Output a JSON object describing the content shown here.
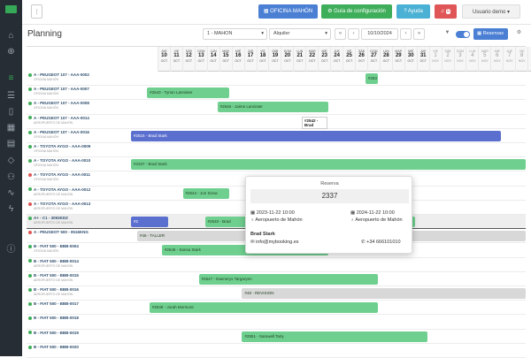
{
  "topbar": {
    "office": "OFICINA MAHÓN",
    "config": "Guía de configuración",
    "help": "Ayuda",
    "notif_count": "0",
    "user": "Usuario demo"
  },
  "planning": {
    "title": "Planning",
    "office_select": "1 - MAHON",
    "type_select": "Alquiler",
    "date": "10/10/2024",
    "reservas": "Reservas"
  },
  "days": [
    {
      "w": "JUE",
      "d": "10",
      "m": "OCT"
    },
    {
      "w": "VIE",
      "d": "11",
      "m": "OCT"
    },
    {
      "w": "SÁB",
      "d": "12",
      "m": "OCT"
    },
    {
      "w": "DOM",
      "d": "13",
      "m": "OCT"
    },
    {
      "w": "LUN",
      "d": "14",
      "m": "OCT"
    },
    {
      "w": "MAR",
      "d": "15",
      "m": "OCT"
    },
    {
      "w": "MIÉ",
      "d": "16",
      "m": "OCT"
    },
    {
      "w": "JUE",
      "d": "17",
      "m": "OCT"
    },
    {
      "w": "VIE",
      "d": "18",
      "m": "OCT"
    },
    {
      "w": "SÁB",
      "d": "19",
      "m": "OCT"
    },
    {
      "w": "DOM",
      "d": "20",
      "m": "OCT"
    },
    {
      "w": "LUN",
      "d": "21",
      "m": "OCT"
    },
    {
      "w": "MAR",
      "d": "22",
      "m": "OCT"
    },
    {
      "w": "MIÉ",
      "d": "23",
      "m": "OCT"
    },
    {
      "w": "JUE",
      "d": "24",
      "m": "OCT"
    },
    {
      "w": "VIE",
      "d": "25",
      "m": "OCT"
    },
    {
      "w": "SÁB",
      "d": "26",
      "m": "OCT"
    },
    {
      "w": "DOM",
      "d": "27",
      "m": "OCT"
    },
    {
      "w": "LUN",
      "d": "28",
      "m": "OCT"
    },
    {
      "w": "MAR",
      "d": "29",
      "m": "OCT"
    },
    {
      "w": "MIÉ",
      "d": "30",
      "m": "OCT"
    },
    {
      "w": "JUE",
      "d": "31",
      "m": "OCT"
    },
    {
      "w": "VIE",
      "d": "1",
      "m": "NOV"
    },
    {
      "w": "SÁB",
      "d": "2",
      "m": "NOV"
    },
    {
      "w": "DOM",
      "d": "3",
      "m": "NOV"
    },
    {
      "w": "LUN",
      "d": "4",
      "m": "NOV"
    },
    {
      "w": "MAR",
      "d": "5",
      "m": "NOV"
    },
    {
      "w": "MIÉ",
      "d": "6",
      "m": "NOV"
    },
    {
      "w": "JUE",
      "d": "7",
      "m": "NOV"
    },
    {
      "w": "VIE",
      "d": "8",
      "m": "NOV"
    },
    {
      "w": "SÁB",
      "d": "9",
      "m": "NOV"
    },
    {
      "w": "DOM",
      "d": "10",
      "m": "NOV"
    }
  ],
  "vehicles": [
    {
      "name": "A - PEUGEOT 107 - AAA-0002",
      "sub": "OFICINA MAHÓN",
      "color": "#3fae5a"
    },
    {
      "name": "A - PEUGEOT 107 - AAA-0007",
      "sub": "OFICINA MAHÓN",
      "color": "#3fae5a"
    },
    {
      "name": "A - PEUGEOT 107 - AAA-0008",
      "sub": "OFICINA MAHÓN",
      "color": "#3fae5a"
    },
    {
      "name": "A - PEUGEOT 107 - AAA-0014",
      "sub": "AEROPUERTO DE MAHÓN",
      "color": "#3fae5a"
    },
    {
      "name": "A - PEUGEOT 107 - AAA-0016",
      "sub": "OFICINA MAHÓN",
      "color": "#3fae5a"
    },
    {
      "name": "A - TOYOTA AYGO - AAA-0009",
      "sub": "OFICINA MAHÓN",
      "color": "#3fae5a"
    },
    {
      "name": "A - TOYOTA AYGO - AAA-0010",
      "sub": "OFICINA MAHÓN",
      "color": "#3fae5a"
    },
    {
      "name": "A - TOYOTA AYGO - AAA-0011",
      "sub": "OFICINA MAHÓN",
      "color": "#e05555"
    },
    {
      "name": "A - TOYOTA AYGO - AAA-0012",
      "sub": "AEROPUERTO DE MAHÓN",
      "color": "#3fae5a"
    },
    {
      "name": "A - TOYOTA AYGO - AAA-0013",
      "sub": "AEROPUERTO DE MAHÓN",
      "color": "#e05555"
    },
    {
      "name": "A+ - C1 - 3093KDZ",
      "sub": "AEROPUERTO DE MAHÓN",
      "color": "#3fae5a"
    },
    {
      "name": "A - PEUGEOT 500 - 0516KNG",
      "sub": "",
      "color": "#e05555"
    },
    {
      "name": "B - FIAT 500 - BBB-0004",
      "sub": "OFICINA MAHÓN",
      "color": "#3fae5a"
    },
    {
      "name": "B - FIAT 500 - BBB-0014",
      "sub": "AEROPUERTO DE MAHÓN",
      "color": "#3fae5a"
    },
    {
      "name": "B - FIAT 500 - BBB-0015",
      "sub": "AEROPUERTO DE MAHÓN",
      "color": "#3fae5a"
    },
    {
      "name": "B - FIAT 500 - BBB-0016",
      "sub": "AEROPUERTO DE MAHÓN",
      "color": "#3fae5a"
    },
    {
      "name": "B - FIAT 500 - BBB-0017",
      "sub": "",
      "color": "#3fae5a"
    },
    {
      "name": "B - FIAT 500 - BBB-0018",
      "sub": "",
      "color": "#3fae5a"
    },
    {
      "name": "B - FIAT 500 - BBB-0019",
      "sub": "",
      "color": "#3fae5a"
    },
    {
      "name": "B - FIAT 500 - BBB-0020",
      "sub": "",
      "color": "#3fae5a"
    }
  ],
  "bookings": [
    {
      "row": 0,
      "start": 19.0,
      "end": 20.0,
      "label": "#253",
      "color": "#6fcf8f"
    },
    {
      "row": 1,
      "start": 1.3,
      "end": 8.0,
      "label": "#2543 - Tyrion Lannister",
      "color": "#6fcf8f"
    },
    {
      "row": 2,
      "start": 7.0,
      "end": 16.0,
      "label": "#2546 - Jaime Lannister",
      "color": "#6fcf8f"
    },
    {
      "row": 4,
      "start": 0,
      "end": 30.0,
      "label": "#2515 - Brad Stark",
      "color": "#5b6fcf"
    },
    {
      "row": 6,
      "start": 0,
      "end": 32.0,
      "label": "#2337 - Brad Stark",
      "color": "#6fcf8f"
    },
    {
      "row": 8,
      "start": 4.2,
      "end": 8.0,
      "label": "#2544 - Jon Snow",
      "color": "#6fcf8f"
    },
    {
      "row": 10,
      "start": 0,
      "end": 3.0,
      "label": "#2",
      "color": "#5b6fcf"
    },
    {
      "row": 10,
      "start": 6.0,
      "end": 12.0,
      "label": "#2540 - Brad",
      "color": "#6fcf8f"
    },
    {
      "row": 10,
      "start": 22.0,
      "end": 23.0,
      "label": "",
      "color": "#6fcf8f"
    },
    {
      "row": 11,
      "start": 0.5,
      "end": 32.0,
      "label": "#46 - TALLER",
      "color": "#d8d8d8"
    },
    {
      "row": 12,
      "start": 2.5,
      "end": 16.0,
      "label": "#2545 - Sansa Stark",
      "color": "#6fcf8f"
    },
    {
      "row": 14,
      "start": 5.5,
      "end": 20.0,
      "label": "#2547 - Daenerys Targaryen",
      "color": "#6fcf8f"
    },
    {
      "row": 15,
      "start": 9.0,
      "end": 32.0,
      "label": "#48 - REVISION",
      "color": "#d8d8d8"
    },
    {
      "row": 16,
      "start": 1.5,
      "end": 20.0,
      "label": "#2548 - Jorah Mormont",
      "color": "#6fcf8f"
    },
    {
      "row": 18,
      "start": 9.0,
      "end": 24.0,
      "label": "#2551 - Samwell Tarly",
      "color": "#6fcf8f"
    }
  ],
  "tooltip": {
    "label": "#2542 - Brad"
  },
  "popup": {
    "title": "Reserva",
    "code": "2337",
    "start": "2023-11-22 10:00",
    "start_loc": "Aeropuerto de Mahón",
    "end": "2024-11-22 10:00",
    "end_loc": "Aeropuerto de Mahón",
    "client": "Brad Stark",
    "email": "info@mybooking.es",
    "phone": "+34 666101010"
  }
}
